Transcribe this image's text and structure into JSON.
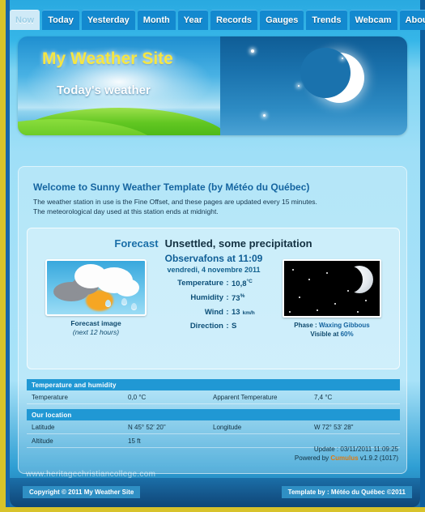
{
  "nav": {
    "tabs": [
      {
        "label": "Now",
        "active": true
      },
      {
        "label": "Today",
        "active": false
      },
      {
        "label": "Yesterday",
        "active": false
      },
      {
        "label": "Month",
        "active": false
      },
      {
        "label": "Year",
        "active": false
      },
      {
        "label": "Records",
        "active": false
      },
      {
        "label": "Gauges",
        "active": false
      },
      {
        "label": "Trends",
        "active": false
      },
      {
        "label": "Webcam",
        "active": false
      },
      {
        "label": "About",
        "active": false
      }
    ]
  },
  "banner": {
    "title": "My Weather Site",
    "subtitle": "Today's weather"
  },
  "welcome": {
    "title": "Welcome to Sunny Weather Template (by Météo du Québec)",
    "line1": "The weather station in use is the Fine Offset, and these pages are updated every 15 minutes.",
    "line2": "The meteorological day used at this station ends at midnight."
  },
  "forecast": {
    "label": "Forecast",
    "value": "Unsettled, some precipitation",
    "image_caption": "Forecast image",
    "image_subcaption": "(next 12 hours)"
  },
  "observations": {
    "title": "Observafons at 11:09",
    "date": "vendredi, 4 novembre 2011",
    "rows": [
      {
        "key": "Temperature",
        "value": "10,8",
        "unit": "°C"
      },
      {
        "key": "Humidity",
        "value": "73",
        "unit": "%"
      },
      {
        "key": "Wind",
        "value": "13",
        "unit": "km/h"
      },
      {
        "key": "Direction",
        "value": "S",
        "unit": ""
      }
    ]
  },
  "moon": {
    "phase_label": "Phase :",
    "phase_value": "Waxing Gibbous",
    "visible_label": "Visible at",
    "visible_value": "60%"
  },
  "sections": [
    {
      "title": "Temperature and humidity",
      "rows": [
        {
          "c1": "Temperature",
          "c2": "0,0 °C",
          "c3": "Apparent Temperature",
          "c4": "7,4 °C"
        }
      ]
    },
    {
      "title": "Our location",
      "rows": [
        {
          "c1": "Latitude",
          "c2": "N 45° 52' 20\"",
          "c3": "Longitude",
          "c4": "W 72° 53' 28\""
        },
        {
          "c1": "Altitude",
          "c2": "15 ft",
          "c3": "",
          "c4": ""
        }
      ]
    }
  ],
  "status": {
    "update": "Update : 03/11/2011 11:09:25",
    "powered_prefix": "Powered by ",
    "powered_brand": "Cumulus",
    "powered_version": " v1.9.2 (1017)"
  },
  "watermark": "www.heritagechristiancollege.com",
  "footer": {
    "copyright": "Copyright © 2011 My Weather Site",
    "template_by": "Template by : Météo du Québec ©2011"
  },
  "colors": {
    "accent": "#1389cf",
    "section_header": "#2098d4",
    "banner_title": "#f5e642",
    "cumulus_orange": "#e07b10",
    "edge_yellow": "#d8c32a"
  }
}
